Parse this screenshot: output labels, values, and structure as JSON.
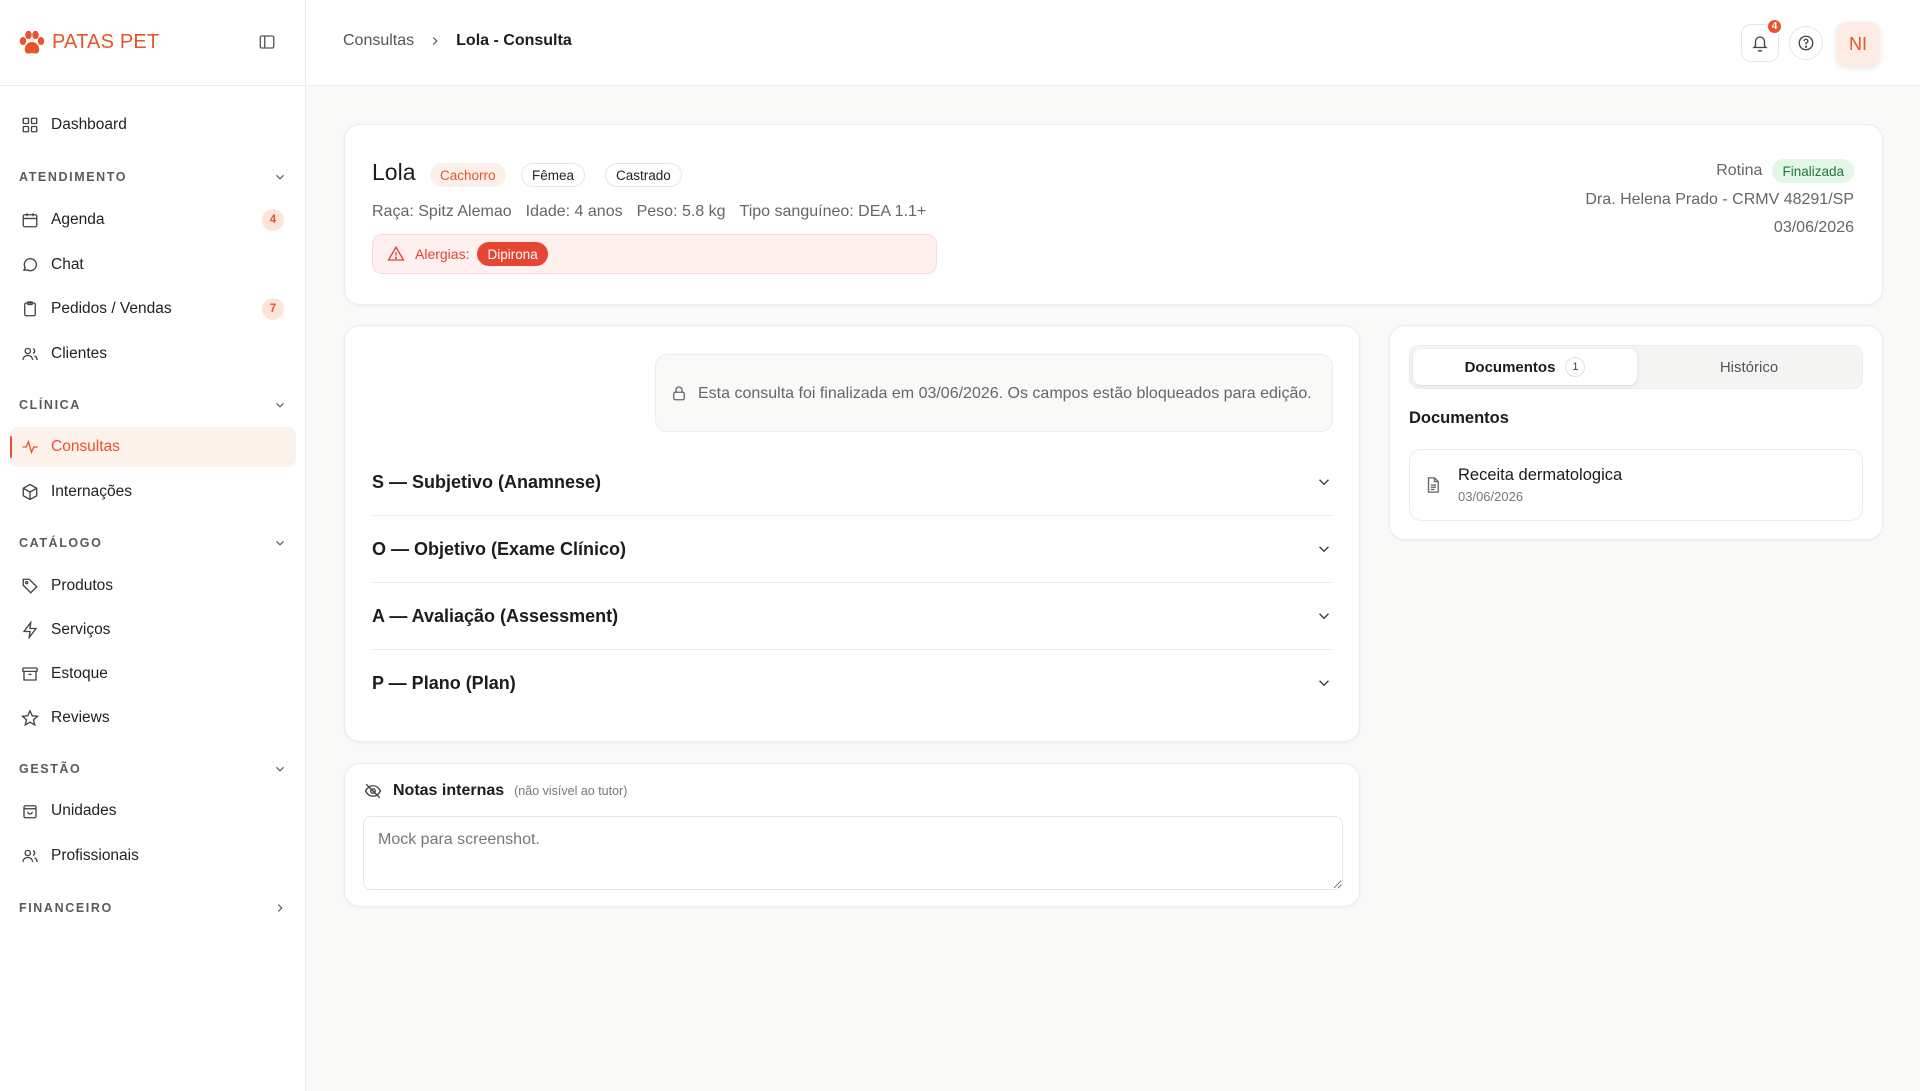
{
  "brand": {
    "name": "PATAS PET",
    "accent": "#e8532a"
  },
  "sidebar": {
    "dashboard": "Dashboard",
    "sections": {
      "atendimento": "ATENDIMENTO",
      "clinica": "CLÍNICA",
      "catalogo": "CATÁLOGO",
      "gestao": "GESTÃO",
      "financeiro": "FINANCEIRO"
    },
    "items": {
      "agenda": {
        "label": "Agenda",
        "badge": "4"
      },
      "chat": {
        "label": "Chat"
      },
      "pedidos": {
        "label": "Pedidos / Vendas",
        "badge": "7"
      },
      "clientes": {
        "label": "Clientes"
      },
      "consultas": {
        "label": "Consultas"
      },
      "internacoes": {
        "label": "Internações"
      },
      "produtos": {
        "label": "Produtos"
      },
      "servicos": {
        "label": "Serviços"
      },
      "estoque": {
        "label": "Estoque"
      },
      "reviews": {
        "label": "Reviews"
      },
      "unidades": {
        "label": "Unidades"
      },
      "profissionais": {
        "label": "Profissionais"
      }
    }
  },
  "header": {
    "breadcrumb": {
      "parent": "Consultas",
      "current": "Lola - Consulta"
    },
    "notifications_count": "4",
    "avatar_initials": "NI"
  },
  "patient": {
    "name": "Lola",
    "species": "Cachorro",
    "sex": "Fêmea",
    "neutered": "Castrado",
    "breed": "Raça: Spitz Alemao",
    "age": "Idade: 4 anos",
    "weight": "Peso: 5.8 kg",
    "blood_type": "Tipo sanguíneo: DEA 1.1+",
    "allergies_label": "Alergias:",
    "allergy": "Dipirona"
  },
  "consult": {
    "type": "Rotina",
    "status": "Finalizada",
    "vet": "Dra. Helena Prado - CRMV 48291/SP",
    "date": "03/06/2026",
    "lock_notice": "Esta consulta foi finalizada em 03/06/2026. Os campos estão bloqueados para edição.",
    "soap": [
      "S — Subjetivo (Anamnese)",
      "O — Objetivo (Exame Clínico)",
      "A — Avaliação (Assessment)",
      "P — Plano (Plan)"
    ]
  },
  "notes": {
    "title": "Notas internas",
    "subtitle": "(não visível ao tutor)",
    "value": "Mock para screenshot."
  },
  "docs_panel": {
    "tabs": {
      "documents": "Documentos",
      "documents_count": "1",
      "history": "Histórico"
    },
    "section_title": "Documentos",
    "items": [
      {
        "name": "Receita dermatologica",
        "date": "03/06/2026"
      }
    ]
  }
}
